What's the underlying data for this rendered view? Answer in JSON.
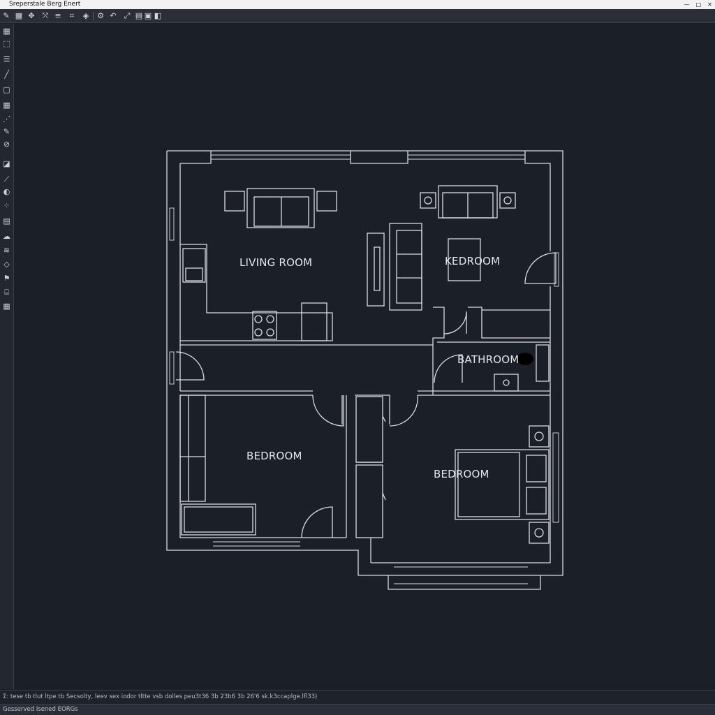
{
  "window": {
    "title": "Sreperstale Berg Enert",
    "controls": [
      "—",
      "□",
      "✕"
    ]
  },
  "toolbar": {
    "icons": [
      "pencil-icon",
      "grid-icon",
      "pan-icon",
      "move-icon",
      "layers-icon",
      "stamp-icon",
      "snap-icon",
      "node-icon",
      "undo-icon",
      "dimension-icon",
      "print-icon",
      "block-icon",
      "window-icon"
    ],
    "glyphs": [
      "✎",
      "▦",
      "✥",
      "⤧",
      "≡",
      "⌗",
      "◈",
      "⚙",
      "↶",
      "⤢",
      "▤",
      "▣",
      "◧"
    ]
  },
  "left_toolbar": {
    "glyphs": [
      "▦",
      "⬚",
      "☰",
      "╱",
      "▢",
      "▦",
      "⋰",
      "✎",
      "⊘",
      "◪",
      "⟋",
      "◐",
      "⁘",
      "▤",
      "☁",
      "≋",
      "◇",
      "⚑",
      "⌸",
      "▦"
    ]
  },
  "plan": {
    "rooms": [
      {
        "label": "LIVING ROOM"
      },
      {
        "label": "KEDROOM"
      },
      {
        "label": "BATHROOM"
      },
      {
        "label": "BEDROOM"
      },
      {
        "label": "BEDROOM"
      }
    ]
  },
  "command_line": {
    "text": "Σ: tese tb tlut ltpe tb Secsolty, leev sex iodor tltte vsb dolles peu3t36 3b 23b6 3b  26'6 sk.k3ccaplge.lfl33)"
  },
  "status_bar": {
    "text": "Gesserved Isened EORGs"
  }
}
